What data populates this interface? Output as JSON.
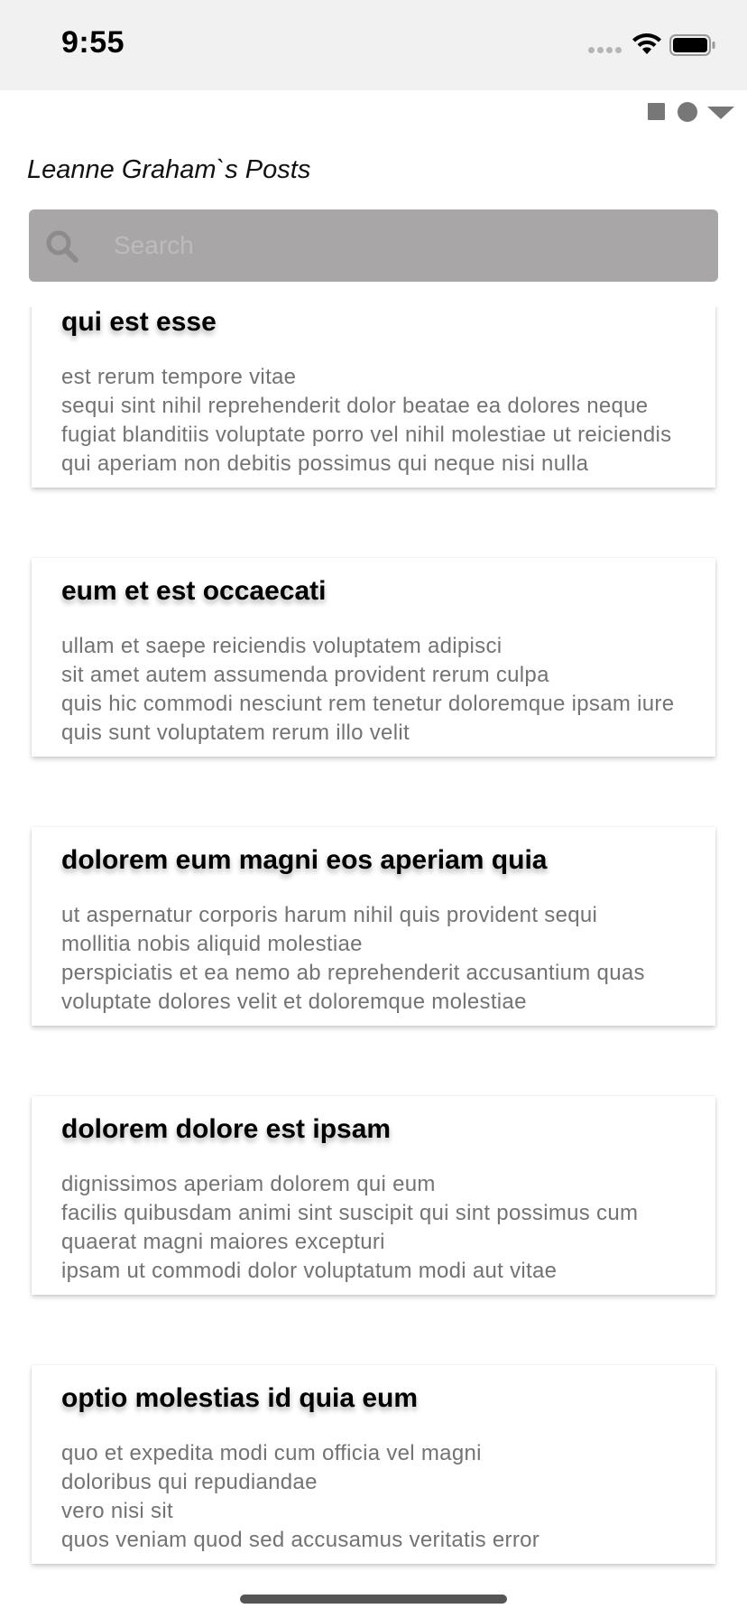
{
  "status_bar": {
    "time": "9:55"
  },
  "toolbar": {
    "icons": [
      "stop-icon",
      "record-icon",
      "dropdown-icon"
    ]
  },
  "page": {
    "title": "Leanne Graham`s Posts"
  },
  "search": {
    "placeholder": "Search",
    "value": ""
  },
  "posts": [
    {
      "title": "qui est esse",
      "body": "est rerum tempore vitae\nsequi sint nihil reprehenderit dolor beatae ea dolores neque\nfugiat blanditiis voluptate porro vel nihil molestiae ut reiciendis\nqui aperiam non debitis possimus qui neque nisi nulla"
    },
    {
      "title": "eum et est occaecati",
      "body": "ullam et saepe reiciendis voluptatem adipisci\nsit amet autem assumenda provident rerum culpa\nquis hic commodi nesciunt rem tenetur doloremque ipsam iure\nquis sunt voluptatem rerum illo velit"
    },
    {
      "title": "dolorem eum magni eos aperiam quia",
      "body": "ut aspernatur corporis harum nihil quis provident sequi\nmollitia nobis aliquid molestiae\nperspiciatis et ea nemo ab reprehenderit accusantium quas\nvoluptate dolores velit et doloremque molestiae"
    },
    {
      "title": "dolorem dolore est ipsam",
      "body": "dignissimos aperiam dolorem qui eum\nfacilis quibusdam animi sint suscipit qui sint possimus cum\nquaerat magni maiores excepturi\nipsam ut commodi dolor voluptatum modi aut vitae"
    },
    {
      "title": "optio molestias id quia eum",
      "body": "quo et expedita modi cum officia vel magni\ndoloribus qui repudiandae\nvero nisi sit\nquos veniam quod sed accusamus veritatis error"
    }
  ],
  "colors": {
    "status_bar_bg": "#f1f1f1",
    "search_bg": "#a8a6a7",
    "body_text": "#737373",
    "title_text": "#000000"
  }
}
